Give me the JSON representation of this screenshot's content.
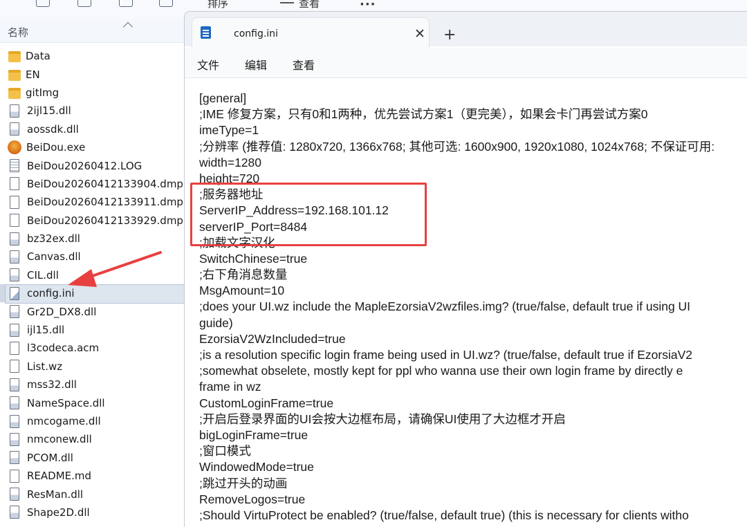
{
  "explorer": {
    "toolbar": {
      "sort_label": "排序",
      "view_label": "查看",
      "more_label": "···"
    },
    "column_header": "名称",
    "files": [
      {
        "name": "Data",
        "type": "folder"
      },
      {
        "name": "EN",
        "type": "folder"
      },
      {
        "name": "gitImg",
        "type": "folder"
      },
      {
        "name": "2ijl15.dll",
        "type": "dll"
      },
      {
        "name": "aossdk.dll",
        "type": "dll"
      },
      {
        "name": "BeiDou.exe",
        "type": "exe"
      },
      {
        "name": "BeiDou20260412.LOG",
        "type": "log"
      },
      {
        "name": "BeiDou20260412133904.dmp",
        "type": "doc"
      },
      {
        "name": "BeiDou20260412133911.dmp",
        "type": "doc"
      },
      {
        "name": "BeiDou20260412133929.dmp",
        "type": "doc"
      },
      {
        "name": "bz32ex.dll",
        "type": "dll"
      },
      {
        "name": "Canvas.dll",
        "type": "dll"
      },
      {
        "name": "CIL.dll",
        "type": "dll"
      },
      {
        "name": "config.ini",
        "type": "ini",
        "selected": true
      },
      {
        "name": "Gr2D_DX8.dll",
        "type": "dll"
      },
      {
        "name": "ijl15.dll",
        "type": "dll"
      },
      {
        "name": "l3codeca.acm",
        "type": "doc"
      },
      {
        "name": "List.wz",
        "type": "doc"
      },
      {
        "name": "mss32.dll",
        "type": "dll"
      },
      {
        "name": "NameSpace.dll",
        "type": "dll"
      },
      {
        "name": "nmcogame.dll",
        "type": "dll"
      },
      {
        "name": "nmconew.dll",
        "type": "dll"
      },
      {
        "name": "PCOM.dll",
        "type": "dll"
      },
      {
        "name": "README.md",
        "type": "doc"
      },
      {
        "name": "ResMan.dll",
        "type": "dll"
      },
      {
        "name": "Shape2D.dll",
        "type": "dll"
      }
    ]
  },
  "notepad": {
    "tab_title": "config.ini",
    "close_glyph": "✕",
    "new_tab_glyph": "+",
    "menu": [
      "文件",
      "编辑",
      "查看"
    ],
    "lines": [
      "[general]",
      ";IME 修复方案，只有0和1两种，优先尝试方案1（更完美），如果会卡门再尝试方案0",
      "imeType=1",
      ";分辨率 (推荐值: 1280x720, 1366x768; 其他可选: 1600x900, 1920x1080, 1024x768; 不保证可用:",
      "width=1280",
      "height=720",
      ";服务器地址",
      "ServerIP_Address=192.168.101.12",
      "serverIP_Port=8484",
      ";加载文字汉化",
      "SwitchChinese=true",
      ";右下角消息数量",
      "MsgAmount=10",
      ";does your UI.wz include the MapleEzorsiaV2wzfiles.img? (true/false, default true if using UI",
      "guide)",
      "EzorsiaV2WzIncluded=true",
      ";is a resolution specific login frame being used in UI.wz? (true/false, default true if EzorsiaV2",
      ";somewhat obselete, mostly kept for ppl who wanna use their own login frame by directly e",
      "frame in wz",
      "CustomLoginFrame=true",
      ";开启后登录界面的UI会按大边框布局，请确保UI使用了大边框才开启",
      "bigLoginFrame=true",
      ";窗口模式",
      "WindowedMode=true",
      ";跳过开头的动画",
      "RemoveLogos=true",
      ";Should VirtuProtect be enabled? (true/false, default true) (this is necessary for clients witho"
    ]
  },
  "colors": {
    "annotation_red": "#e84040",
    "selection": "#dde5ef",
    "folder": "#f4c04a"
  }
}
